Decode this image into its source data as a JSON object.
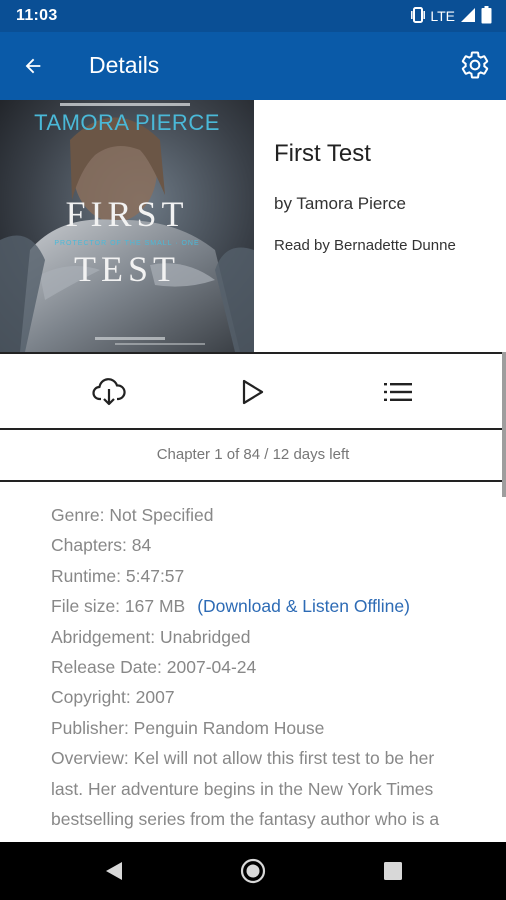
{
  "status_bar": {
    "time": "11:03",
    "network": "LTE"
  },
  "app_bar": {
    "title": "Details"
  },
  "book": {
    "cover_author": "TAMORA PIERCE",
    "cover_title_line1": "FIRST",
    "cover_title_line2": "TEST",
    "cover_series": "PROTECTOR OF THE SMALL · ONE",
    "title": "First Test",
    "author": "by Tamora Pierce",
    "narrator": "Read by Bernadette Dunne"
  },
  "actions": [
    "download-icon",
    "play-icon",
    "chapter-list-icon"
  ],
  "chapter_status": "Chapter 1 of 84 / 12 days left",
  "details": {
    "genre": "Genre: Not Specified",
    "chapters": "Chapters: 84",
    "runtime": "Runtime: 5:47:57",
    "file_size": "File size: 167 MB",
    "download_link": "(Download & Listen Offline)",
    "abridgement": "Abridgement: Unabridged",
    "release_date": "Release Date: 2007-04-24",
    "copyright": "Copyright: 2007",
    "publisher": "Publisher: Penguin Random House",
    "overview": "Overview: Kel will not allow this first test to be her last. Her adventure begins in the New York Times bestselling series from the fantasy author who is a legend herself: TAMORA PIERCE."
  },
  "colors": {
    "status_bar": "#0a4f95",
    "app_bar": "#0a5aa8",
    "link": "#2d6bb5",
    "detail_text": "#888888"
  }
}
